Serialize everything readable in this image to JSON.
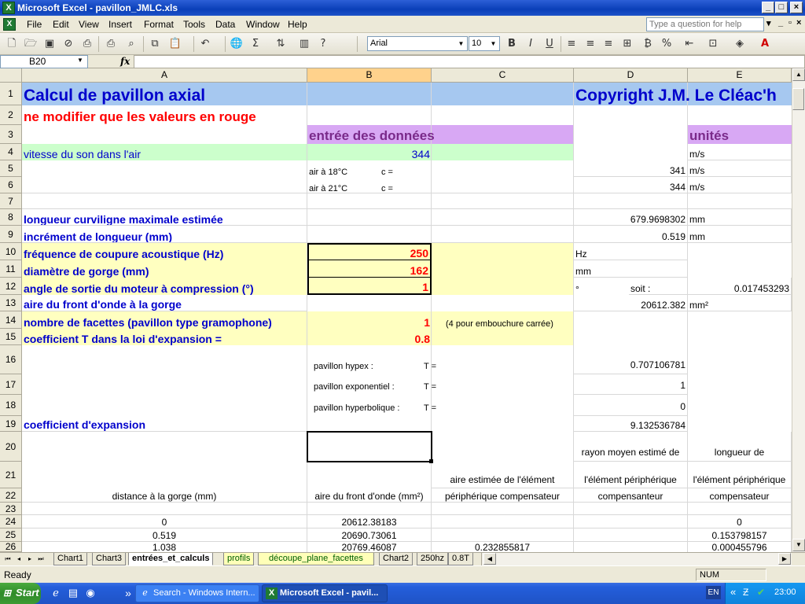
{
  "window": {
    "title": "Microsoft Excel - pavillon_JMLC.xls",
    "app_icon": "X",
    "controls": [
      "_",
      "□",
      "×"
    ]
  },
  "menu": {
    "items": [
      "File",
      "Edit",
      "View",
      "Insert",
      "Format",
      "Tools",
      "Data",
      "Window",
      "Help"
    ],
    "help_placeholder": "Type a question for help"
  },
  "toolbar": {
    "font_name": "Arial",
    "font_size": "10",
    "icons": [
      "new-icon",
      "open-icon",
      "save-icon",
      "permission-icon",
      "print-icon",
      "print-preview-icon",
      "spelling-icon",
      "research-icon",
      "copy-icon",
      "paste-icon",
      "undo-icon",
      "hyperlink-icon",
      "autosum-icon",
      "sort-icon",
      "chart-wizard-icon",
      "help-icon"
    ],
    "format": {
      "bold": "B",
      "italic": "I",
      "underline": "U",
      "percent": "%",
      "sigma": "Σ"
    }
  },
  "formula_bar": {
    "name_box": "B20",
    "fx_label": "fx",
    "formula": ""
  },
  "grid": {
    "columns": [
      "A",
      "B",
      "C",
      "D",
      "E"
    ],
    "selected_column": "B",
    "rows": [
      "1",
      "2",
      "3",
      "4",
      "5",
      "6",
      "7",
      "8",
      "9",
      "10",
      "11",
      "12",
      "13",
      "14",
      "15",
      "16",
      "17",
      "18",
      "19",
      "20",
      "21",
      "22",
      "23",
      "24",
      "25",
      "26"
    ],
    "cells": {
      "A1": "Calcul de pavillon axial",
      "D1": "Copyright J.M. Le Cléac'h",
      "A2": "ne modifier que les valeurs en rouge",
      "B3": "entrée des données",
      "E3": "unités",
      "A4": "vitesse du son dans l'air",
      "B4": "344",
      "E4": "m/s",
      "B5": "air à 18°C",
      "B5b": "c =",
      "D5": "341",
      "E5": "m/s",
      "B6": "air à 21°C",
      "B6b": "c =",
      "D6": "344",
      "E6": "m/s",
      "A8": "longueur curviligne maximale estimée",
      "D8": "679.9698302",
      "E8": "mm",
      "A9": "incrément de longueur (mm)",
      "D9": "0.519",
      "E9": "mm",
      "A10": "fréquence de coupure acoustique (Hz)",
      "B10": "250",
      "D10": "Hz",
      "A11": "diamètre de gorge (mm)",
      "B11": "162",
      "D11": "mm",
      "A12": "angle de sortie du moteur à compression (°)",
      "B12": "1",
      "D12": "°",
      "D12b": "soit :",
      "E12": "0.017453293",
      "A13": "aire du front d'onde à la gorge",
      "D13": "20612.382",
      "E13": "mm²",
      "A14": "nombre de facettes (pavillon type gramophone)",
      "B14": "1",
      "C14": "(4 pour embouchure carrée)",
      "A15": "coefficient T dans la loi d'expansion =",
      "B15": "0.8",
      "B16": "pavillon hypex :",
      "B16b": "T =",
      "D16": "0.707106781",
      "B17": "pavillon exponentiel :",
      "B17b": "T =",
      "D17": "1",
      "B18": "pavillon hyperbolique :",
      "B18b": "T =",
      "D18": "0",
      "A19": "coefficient d'expansion",
      "D19": "9.132536784",
      "D20": "rayon moyen estimé de",
      "E20": "longueur de",
      "C21": "aire estimée de l'élément",
      "D21": "l'élément périphérique",
      "E21": "l'élément périphérique",
      "A22": "distance à la gorge  (mm)",
      "B22": "aire du front d'onde (mm²)",
      "C22": "périphérique compensateur",
      "D22": "compensanteur",
      "E22": "compensateur",
      "A24": "0",
      "B24": "20612.38183",
      "E24": "0",
      "A25": "0.519",
      "B25": "20690.73061",
      "E25": "0.153798157",
      "A26": "1.038",
      "B26": "20769.46087",
      "C26": "0.232855817",
      "E26": "0.000455796"
    },
    "colors": {
      "title_band": "#a6c8f0",
      "purple_band": "#d8a8f4",
      "green_band": "#ccffcc",
      "yellow_band": "#ffffc0",
      "input_red": "#ff0000",
      "label_blue": "#0000cc"
    }
  },
  "sheets": {
    "tabs": [
      "Chart1",
      "Chart3",
      "entrées_et_calculs",
      "profils",
      "découpe_plane_facettes",
      "Chart2",
      "250hz",
      "0.8T"
    ],
    "active": "entrées_et_calculs",
    "nav": [
      "⏮",
      "◂",
      "▸",
      "⏭"
    ]
  },
  "status": {
    "text": "Ready",
    "num": "NUM"
  },
  "taskbar": {
    "start": "Start",
    "items": [
      {
        "label": "Search - Windows Intern...",
        "icon": "ie-icon"
      },
      {
        "label": "Microsoft Excel - pavil...",
        "icon": "excel-icon"
      }
    ],
    "lang": "EN",
    "clock": "23:00",
    "quicklaunch_more": "»",
    "tray_more": "«"
  }
}
